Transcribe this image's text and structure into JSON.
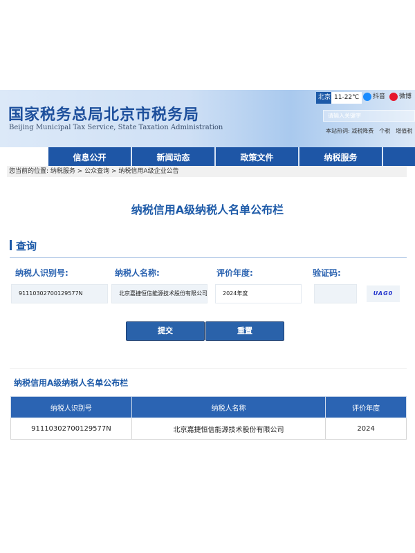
{
  "header": {
    "title_cn": "国家税务总局北京市税务局",
    "title_en": "Beijing Municipal Tax Service, State Taxation Administration",
    "city": "北京",
    "temperature": "11-22℃",
    "social": [
      {
        "label": "抖音",
        "icon": "douyin-icon",
        "color": "#1a8cff"
      },
      {
        "label": "微博",
        "icon": "weibo-icon",
        "color": "#e6162d"
      }
    ],
    "search_placeholder": "请输入关键字",
    "hot_words": "本站热词: 减税降费　个税　增值税"
  },
  "nav": [
    "信息公开",
    "新闻动态",
    "政策文件",
    "纳税服务"
  ],
  "breadcrumb": "您当前的位置: 纳税服务 > 公众查询 > 纳税信用A级企业公告",
  "page_title": "纳税信用A级纳税人名单公布栏",
  "query": {
    "title": "查询",
    "labels": [
      "纳税人识别号:",
      "纳税人名称:",
      "评价年度:",
      "验证码:"
    ],
    "taxpayer_id": "91110302700129577N",
    "taxpayer_name": "北京嘉捷恒信能源技术股份有限公司",
    "year": "2024年度",
    "captcha_input": "",
    "captcha_image": "UAG0",
    "submit": "提交",
    "reset": "重置"
  },
  "results": {
    "title": "纳税信用A级纳税人名单公布栏",
    "columns": [
      "纳税人识别号",
      "纳税人名称",
      "评价年度"
    ],
    "rows": [
      [
        "91110302700129577N",
        "北京嘉捷恒信能源技术股份有限公司",
        "2024"
      ]
    ]
  }
}
